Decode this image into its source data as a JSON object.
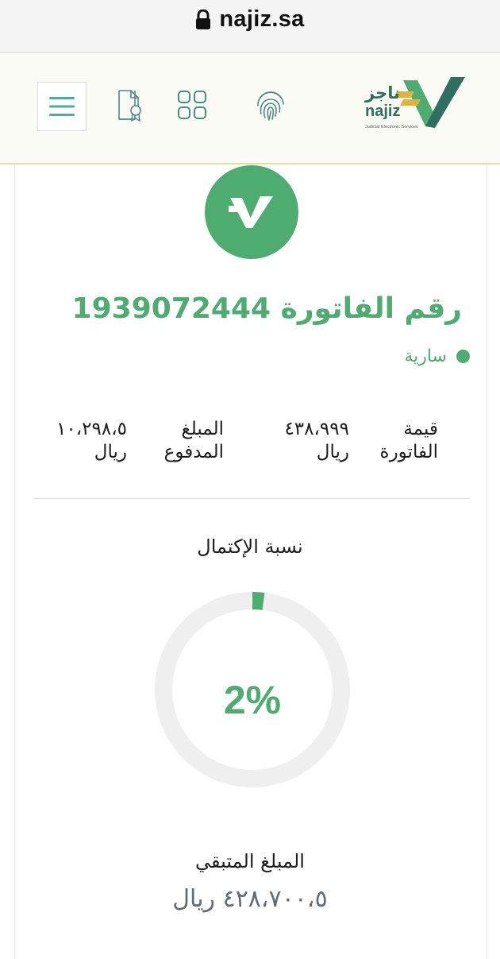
{
  "browser": {
    "url": "najiz.sa"
  },
  "header": {
    "logo_arabic": "ناجز",
    "logo_latin": "najiz",
    "logo_tagline": "Judicial Electronic Services",
    "icons": [
      "menu-icon",
      "certificate-icon",
      "grid-icon",
      "fingerprint-icon"
    ]
  },
  "invoice": {
    "title": "رقم الفاتورة 1939072444",
    "status": "سارية",
    "invoice_value_label": "قيمة الفاتورة",
    "invoice_value": "٤٣٨،٩٩٩ ريال",
    "paid_label": "المبلغ المدفوع",
    "paid_value": "١٠،٢٩٨،٥ ريال"
  },
  "progress": {
    "label": "نسبة الإكتمال",
    "percent_text": "2%",
    "fraction": 0.02,
    "remaining_label": "المبلغ المتبقي",
    "remaining_value": "٤٢٨،٧٠٠،٥ ريال"
  },
  "colors": {
    "accent": "#4fac70",
    "logo_dark": "#2f6f5f",
    "logo_gold": "#e2b23f",
    "track": "#efefef"
  }
}
